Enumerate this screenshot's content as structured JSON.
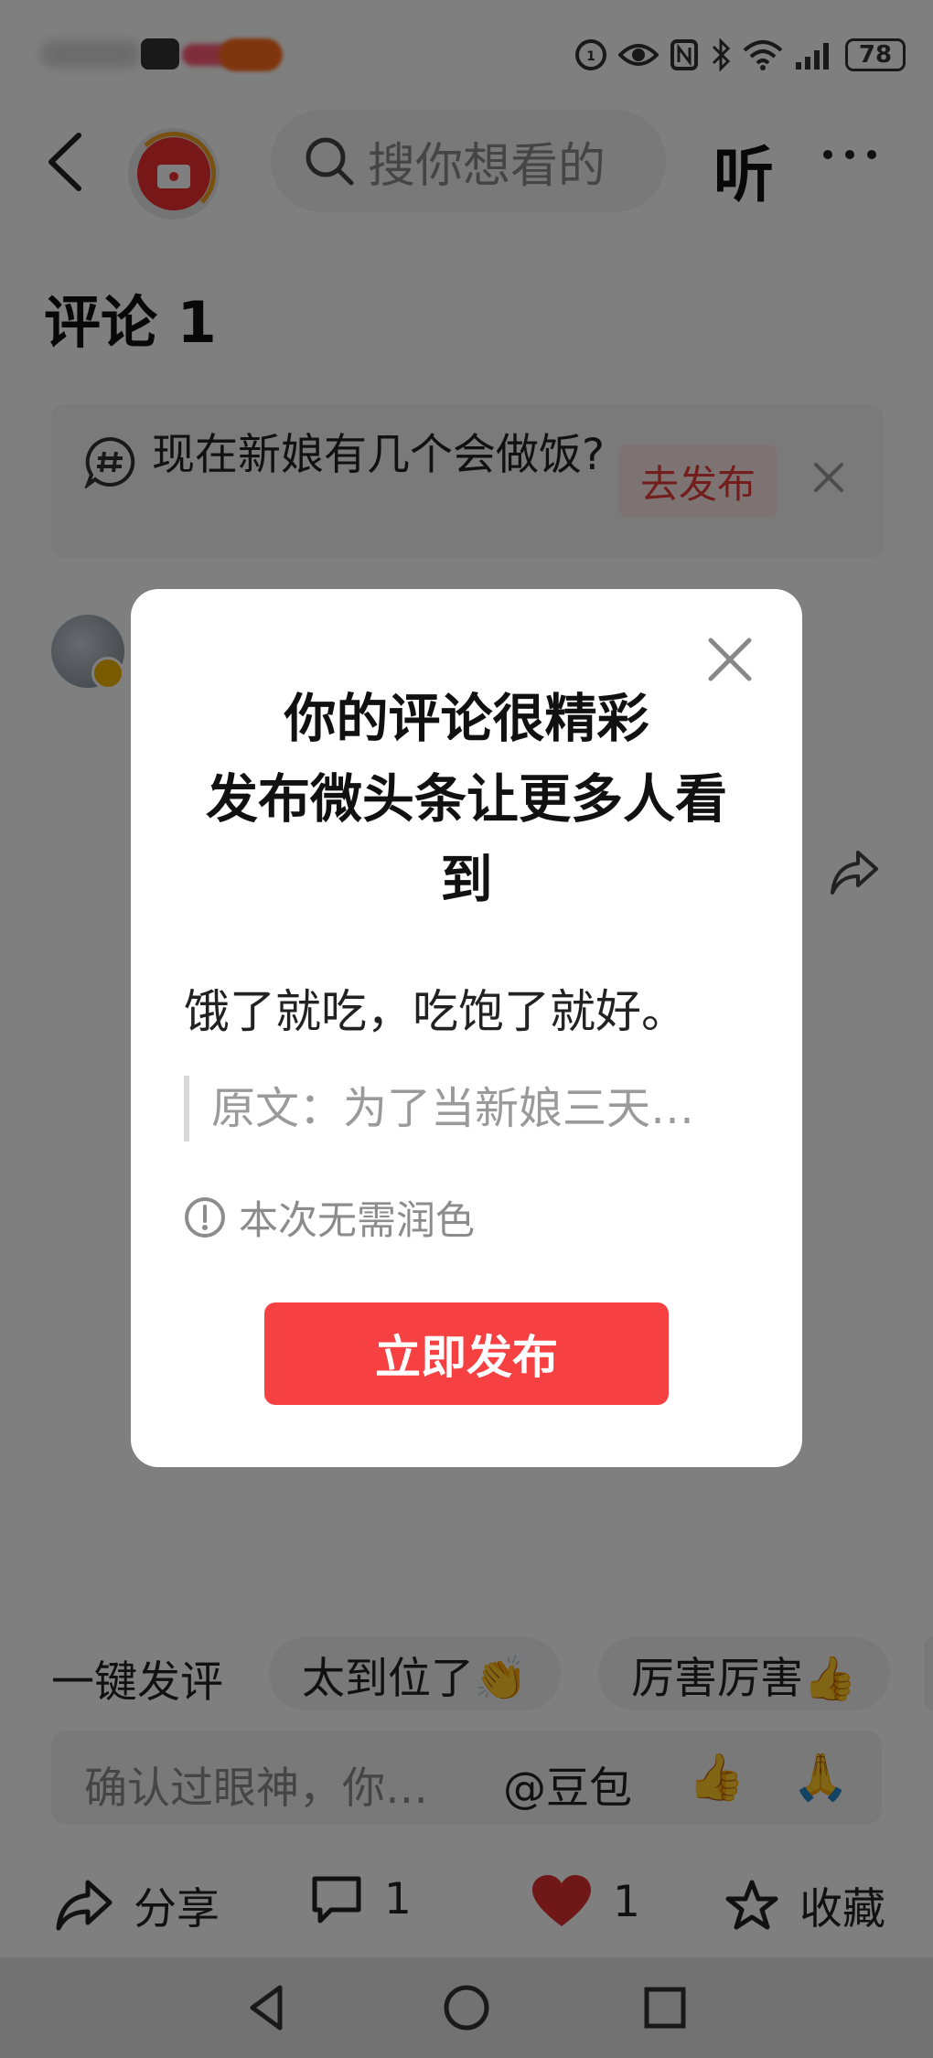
{
  "status_bar": {
    "battery": "78"
  },
  "header": {
    "search_placeholder": "搜你想看的",
    "listen_label": "听"
  },
  "comments": {
    "title": "评论 1"
  },
  "topic_card": {
    "text": "现在新娘有几个会做饭?",
    "publish_label": "去发布"
  },
  "modal": {
    "title_line1": "你的评论很精彩",
    "title_line2": "发布微头条让更多人看到",
    "comment_text": "饿了就吃，吃饱了就好。",
    "quote_text": "原文：为了当新娘三天…",
    "note_text": "本次无需润色",
    "publish_button": "立即发布"
  },
  "quick_reply": {
    "label": "一键发评",
    "chips": [
      "太到位了👏",
      "厉害厉害👍"
    ]
  },
  "comment_input": {
    "placeholder": "确认过眼神，你…",
    "mention": "@豆包",
    "emoji_thumb": "👍",
    "emoji_pray": "🙏"
  },
  "action_bar": {
    "share_label": "分享",
    "comment_count": "1",
    "like_count": "1",
    "favorite_label": "收藏"
  },
  "icons": {
    "back": "chevron-left-icon",
    "search": "search-icon",
    "more": "more-dots-icon",
    "close": "close-icon",
    "share": "share-icon",
    "comment": "comment-bubble-icon",
    "like": "heart-icon",
    "favorite": "star-icon",
    "info": "exclamation-circle-icon"
  },
  "colors": {
    "accent_red": "#f64041",
    "topic_button_bg": "#fde6e6",
    "like_red": "#e02e2e"
  }
}
